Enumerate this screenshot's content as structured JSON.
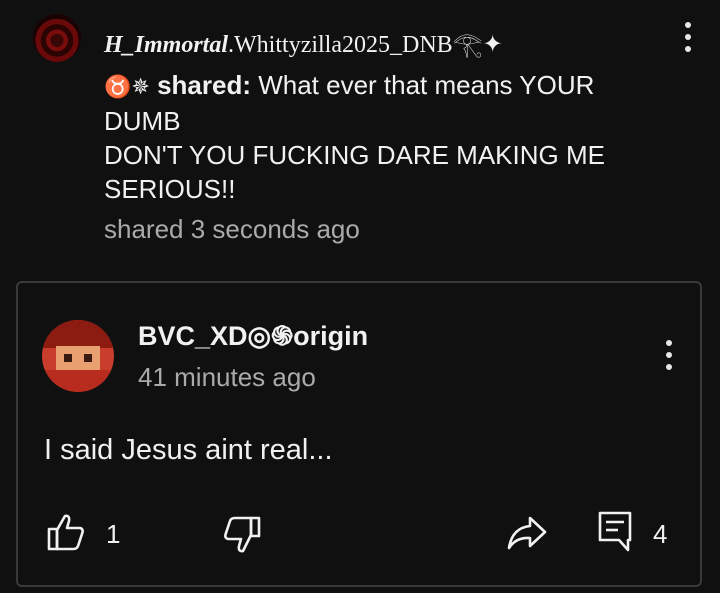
{
  "post": {
    "username_italic": "H_Immortal",
    "username_rest": ".Whittyzilla2025_DNB",
    "username_symbols": "𓂀✦",
    "shared_symbols": "♉✵",
    "shared_label": "shared:",
    "shared_message_line1": " What ever that means YOUR",
    "shared_message_line2": "DUMB",
    "shared_message_line3": "DON'T YOU FUCKING DARE MAKING ME",
    "shared_message_line4": "SERIOUS!!",
    "shared_time": "shared 3 seconds ago"
  },
  "comment": {
    "username": "BVC_XD◎֍origin",
    "time": "41 minutes ago",
    "body": "I said Jesus aint real...",
    "like_count": "1",
    "comment_count": "4"
  },
  "icons": {
    "menu": "more-vert-icon",
    "like": "thumbs-up-icon",
    "dislike": "thumbs-down-icon",
    "share": "share-icon",
    "comment": "comment-icon"
  },
  "colors": {
    "background": "#101010",
    "text": "#f1f1f1",
    "secondary_text": "#aaaaaa",
    "card_border": "#3a3a3a"
  }
}
